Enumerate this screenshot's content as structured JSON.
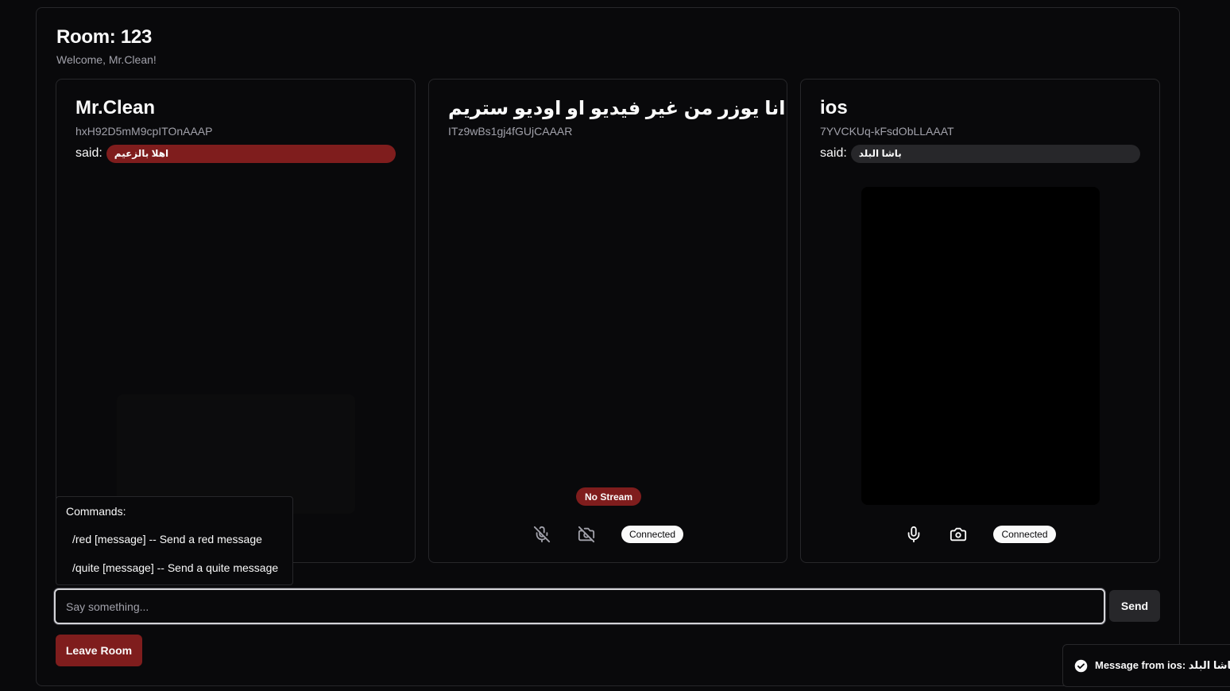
{
  "room": {
    "title": "Room: 123",
    "welcome": "Welcome, Mr.Clean!"
  },
  "participants": [
    {
      "name": "Mr.Clean",
      "id": "hxH92D5mM9cpITOnAAAP",
      "said_label": "said:",
      "said_message": "اهلا بالزعيم",
      "message_style": "red"
    },
    {
      "name": "انا يوزر من غير فيديو او اوديو ستريم",
      "id": "ITz9wBs1gj4fGUjCAAAR",
      "stream_badge": "No Stream",
      "status": "Connected",
      "mic_icon": "mic-off-icon",
      "camera_icon": "camera-off-icon"
    },
    {
      "name": "ios",
      "id": "7YVCKUq-kFsdObLLAAAT",
      "said_label": "said:",
      "said_message": "باشا البلد",
      "message_style": "quiet",
      "status": "Connected",
      "mic_icon": "mic-icon",
      "camera_icon": "camera-icon"
    }
  ],
  "commands": {
    "title": "Commands:",
    "items": [
      "/red [message] -- Send a red message",
      "/quite [message] -- Send a quite message"
    ]
  },
  "chat": {
    "placeholder": "Say something...",
    "send_label": "Send"
  },
  "leave_label": "Leave Room",
  "toast": {
    "message": "Message from ios: باشا البلد",
    "icon": "check-circle-icon"
  },
  "colors": {
    "background": "#09090b",
    "border": "#27272a",
    "danger": "#7f1d1d",
    "muted_text": "#a1a1aa",
    "badge_bg": "#fafafa"
  }
}
